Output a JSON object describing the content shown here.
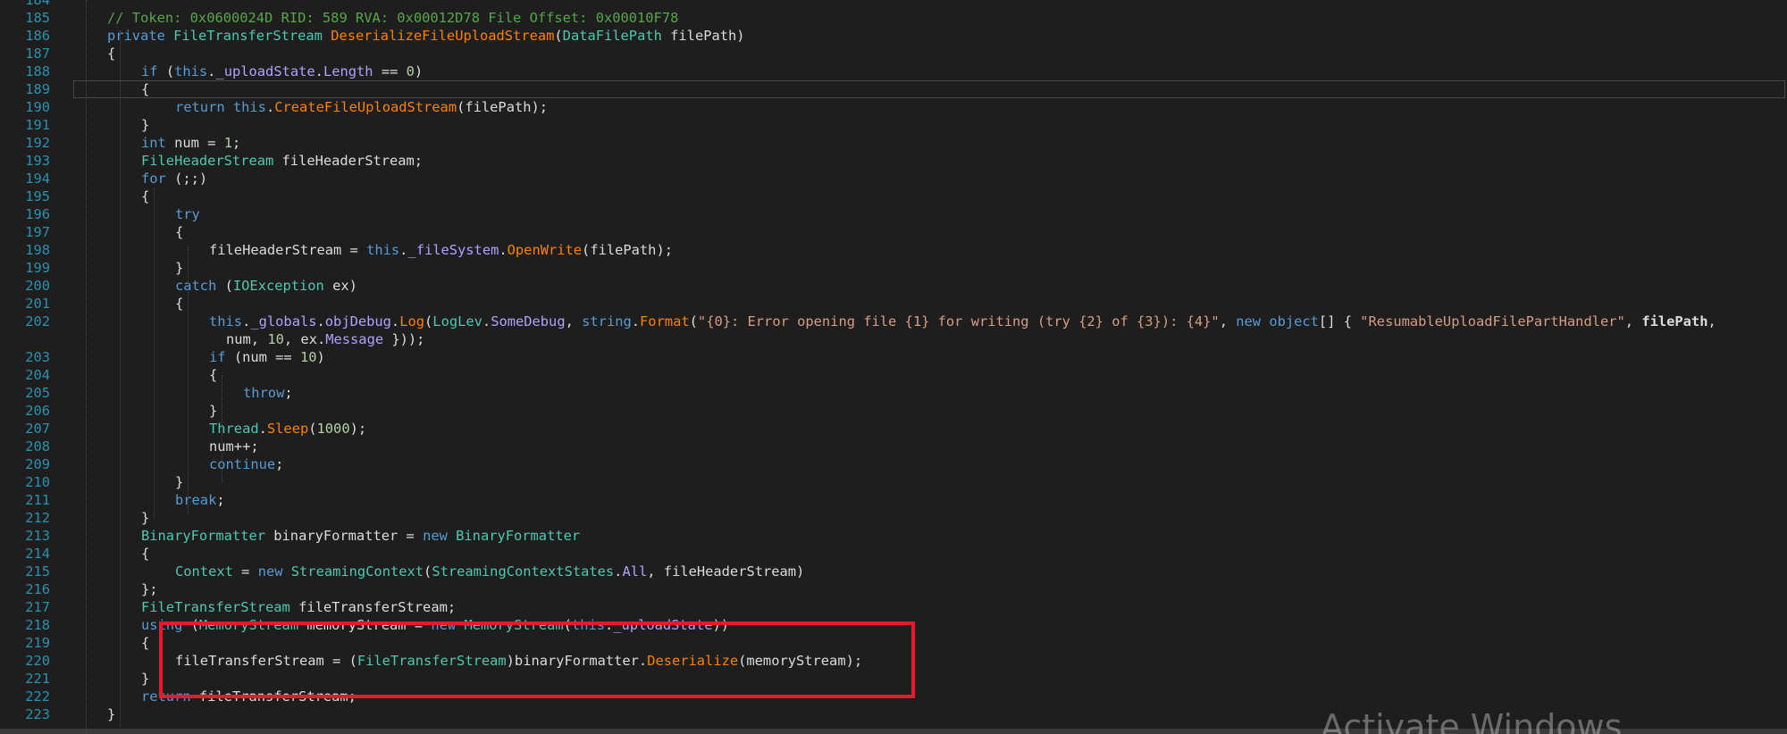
{
  "editor": {
    "line_numbers": [
      "184",
      "185",
      "186",
      "187",
      "188",
      "189",
      "190",
      "191",
      "192",
      "193",
      "194",
      "195",
      "196",
      "197",
      "198",
      "199",
      "200",
      "201",
      "202",
      "",
      "203",
      "204",
      "205",
      "206",
      "207",
      "208",
      "209",
      "210",
      "211",
      "212",
      "213",
      "214",
      "215",
      "216",
      "217",
      "218",
      "219",
      "220",
      "221",
      "222",
      "223"
    ],
    "current_line_number": "189",
    "highlighted_lines": [
      "218",
      "219",
      "220",
      "221"
    ],
    "highlight_color": "#e8192c",
    "colors": {
      "background": "#1e1e1e",
      "keyword": "#569cd6",
      "type": "#4ec9b0",
      "method": "#ff8000",
      "property": "#b4a0ff",
      "comment": "#57a64a",
      "string": "#d69d85",
      "number": "#b5cea8",
      "line_number": "#2b91af"
    },
    "lines": [
      {
        "indent": 0,
        "tokens": []
      },
      {
        "indent": 1,
        "tokens": [
          [
            "cm",
            "// Token: 0x0600024D RID: 589 RVA: 0x00012D78 File Offset: 0x00010F78"
          ]
        ]
      },
      {
        "indent": 1,
        "tokens": [
          [
            "kw",
            "private "
          ],
          [
            "ty",
            "FileTransferStream "
          ],
          [
            "fn",
            "DeserializeFileUploadStream"
          ],
          [
            "tx",
            "("
          ],
          [
            "ty",
            "DataFilePath "
          ],
          [
            "tx",
            "filePath)"
          ]
        ]
      },
      {
        "indent": 1,
        "tokens": [
          [
            "tx",
            "{"
          ]
        ]
      },
      {
        "indent": 2,
        "tokens": [
          [
            "kw",
            "if "
          ],
          [
            "tx",
            "("
          ],
          [
            "kw",
            "this"
          ],
          [
            "tx",
            "."
          ],
          [
            "pr",
            "_uploadState"
          ],
          [
            "tx",
            "."
          ],
          [
            "pr",
            "Length"
          ],
          [
            "tx",
            " == "
          ],
          [
            "nm",
            "0"
          ],
          [
            "tx",
            ")"
          ]
        ]
      },
      {
        "indent": 2,
        "tokens": [
          [
            "tx",
            "{"
          ]
        ]
      },
      {
        "indent": 3,
        "tokens": [
          [
            "kw",
            "return "
          ],
          [
            "kw",
            "this"
          ],
          [
            "tx",
            "."
          ],
          [
            "fn",
            "CreateFileUploadStream"
          ],
          [
            "tx",
            "(filePath);"
          ]
        ]
      },
      {
        "indent": 2,
        "tokens": [
          [
            "tx",
            "}"
          ]
        ]
      },
      {
        "indent": 2,
        "tokens": [
          [
            "kw",
            "int "
          ],
          [
            "tx",
            "num = "
          ],
          [
            "nm",
            "1"
          ],
          [
            "tx",
            ";"
          ]
        ]
      },
      {
        "indent": 2,
        "tokens": [
          [
            "ty",
            "FileHeaderStream "
          ],
          [
            "tx",
            "fileHeaderStream;"
          ]
        ]
      },
      {
        "indent": 2,
        "tokens": [
          [
            "kw",
            "for "
          ],
          [
            "tx",
            "(;;)"
          ]
        ]
      },
      {
        "indent": 2,
        "tokens": [
          [
            "tx",
            "{"
          ]
        ]
      },
      {
        "indent": 3,
        "tokens": [
          [
            "kw",
            "try"
          ]
        ]
      },
      {
        "indent": 3,
        "tokens": [
          [
            "tx",
            "{"
          ]
        ]
      },
      {
        "indent": 4,
        "tokens": [
          [
            "tx",
            "fileHeaderStream = "
          ],
          [
            "kw",
            "this"
          ],
          [
            "tx",
            "."
          ],
          [
            "pr",
            "_fileSystem"
          ],
          [
            "tx",
            "."
          ],
          [
            "fn",
            "OpenWrite"
          ],
          [
            "tx",
            "(filePath);"
          ]
        ]
      },
      {
        "indent": 3,
        "tokens": [
          [
            "tx",
            "}"
          ]
        ]
      },
      {
        "indent": 3,
        "tokens": [
          [
            "kw",
            "catch "
          ],
          [
            "tx",
            "("
          ],
          [
            "ty",
            "IOException "
          ],
          [
            "tx",
            "ex)"
          ]
        ]
      },
      {
        "indent": 3,
        "tokens": [
          [
            "tx",
            "{"
          ]
        ]
      },
      {
        "indent": 4,
        "tokens": [
          [
            "kw",
            "this"
          ],
          [
            "tx",
            "."
          ],
          [
            "pr",
            "_globals"
          ],
          [
            "tx",
            "."
          ],
          [
            "pr",
            "objDebug"
          ],
          [
            "tx",
            "."
          ],
          [
            "fn",
            "Log"
          ],
          [
            "tx",
            "("
          ],
          [
            "ty",
            "LogLev"
          ],
          [
            "tx",
            "."
          ],
          [
            "pr",
            "SomeDebug"
          ],
          [
            "tx",
            ", "
          ],
          [
            "kw",
            "string"
          ],
          [
            "tx",
            "."
          ],
          [
            "fn",
            "Format"
          ],
          [
            "tx",
            "("
          ],
          [
            "st",
            "\"{0}: Error opening file {1} for writing (try {2} of {3}): {4}\""
          ],
          [
            "tx",
            ", "
          ],
          [
            "kw",
            "new "
          ],
          [
            "kw",
            "object"
          ],
          [
            "tx",
            "[] { "
          ],
          [
            "st",
            "\"ResumableUploadFilePartHandler\""
          ],
          [
            "tx",
            ", "
          ],
          [
            "bold",
            "filePath"
          ],
          [
            "tx",
            ","
          ]
        ]
      },
      {
        "indent": 4.5,
        "tokens": [
          [
            "tx",
            "num, "
          ],
          [
            "nm",
            "10"
          ],
          [
            "tx",
            ", ex."
          ],
          [
            "pr",
            "Message"
          ],
          [
            "tx",
            " }));"
          ]
        ]
      },
      {
        "indent": 4,
        "tokens": [
          [
            "kw",
            "if "
          ],
          [
            "tx",
            "(num == "
          ],
          [
            "nm",
            "10"
          ],
          [
            "tx",
            ")"
          ]
        ]
      },
      {
        "indent": 4,
        "tokens": [
          [
            "tx",
            "{"
          ]
        ]
      },
      {
        "indent": 5,
        "tokens": [
          [
            "kw",
            "throw"
          ],
          [
            "tx",
            ";"
          ]
        ]
      },
      {
        "indent": 4,
        "tokens": [
          [
            "tx",
            "}"
          ]
        ]
      },
      {
        "indent": 4,
        "tokens": [
          [
            "ty",
            "Thread"
          ],
          [
            "tx",
            "."
          ],
          [
            "fn",
            "Sleep"
          ],
          [
            "tx",
            "("
          ],
          [
            "nm",
            "1000"
          ],
          [
            "tx",
            ");"
          ]
        ]
      },
      {
        "indent": 4,
        "tokens": [
          [
            "tx",
            "num++;"
          ]
        ]
      },
      {
        "indent": 4,
        "tokens": [
          [
            "kw",
            "continue"
          ],
          [
            "tx",
            ";"
          ]
        ]
      },
      {
        "indent": 3,
        "tokens": [
          [
            "tx",
            "}"
          ]
        ]
      },
      {
        "indent": 3,
        "tokens": [
          [
            "kw",
            "break"
          ],
          [
            "tx",
            ";"
          ]
        ]
      },
      {
        "indent": 2,
        "tokens": [
          [
            "tx",
            "}"
          ]
        ]
      },
      {
        "indent": 2,
        "tokens": [
          [
            "ty",
            "BinaryFormatter "
          ],
          [
            "tx",
            "binaryFormatter = "
          ],
          [
            "kw",
            "new "
          ],
          [
            "ty",
            "BinaryFormatter"
          ]
        ]
      },
      {
        "indent": 2,
        "tokens": [
          [
            "tx",
            "{"
          ]
        ]
      },
      {
        "indent": 3,
        "tokens": [
          [
            "ty",
            "Context"
          ],
          [
            "tx",
            " = "
          ],
          [
            "kw",
            "new "
          ],
          [
            "ty",
            "StreamingContext"
          ],
          [
            "tx",
            "("
          ],
          [
            "ty",
            "StreamingContextStates"
          ],
          [
            "tx",
            "."
          ],
          [
            "pr",
            "All"
          ],
          [
            "tx",
            ", fileHeaderStream)"
          ]
        ]
      },
      {
        "indent": 2,
        "tokens": [
          [
            "tx",
            "};"
          ]
        ]
      },
      {
        "indent": 2,
        "tokens": [
          [
            "ty",
            "FileTransferStream "
          ],
          [
            "tx",
            "fileTransferStream;"
          ]
        ]
      },
      {
        "indent": 2,
        "tokens": [
          [
            "kw",
            "using "
          ],
          [
            "tx",
            "("
          ],
          [
            "ty",
            "MemoryStream "
          ],
          [
            "tx",
            "memoryStream = "
          ],
          [
            "kw",
            "new "
          ],
          [
            "ty",
            "MemoryStream"
          ],
          [
            "tx",
            "("
          ],
          [
            "kw",
            "this"
          ],
          [
            "tx",
            "."
          ],
          [
            "pr",
            "_uploadState"
          ],
          [
            "tx",
            "))"
          ]
        ]
      },
      {
        "indent": 2,
        "tokens": [
          [
            "tx",
            "{"
          ]
        ]
      },
      {
        "indent": 3,
        "tokens": [
          [
            "tx",
            "fileTransferStream = ("
          ],
          [
            "ty",
            "FileTransferStream"
          ],
          [
            "tx",
            ")binaryFormatter."
          ],
          [
            "fn",
            "Deserialize"
          ],
          [
            "tx",
            "(memoryStream);"
          ]
        ]
      },
      {
        "indent": 2,
        "tokens": [
          [
            "tx",
            "}"
          ]
        ]
      },
      {
        "indent": 2,
        "tokens": [
          [
            "kw",
            "return "
          ],
          [
            "tx",
            "fileTransferStream;"
          ]
        ]
      },
      {
        "indent": 1,
        "tokens": [
          [
            "tx",
            "}"
          ]
        ]
      }
    ]
  },
  "watermark": "Activate Windows"
}
